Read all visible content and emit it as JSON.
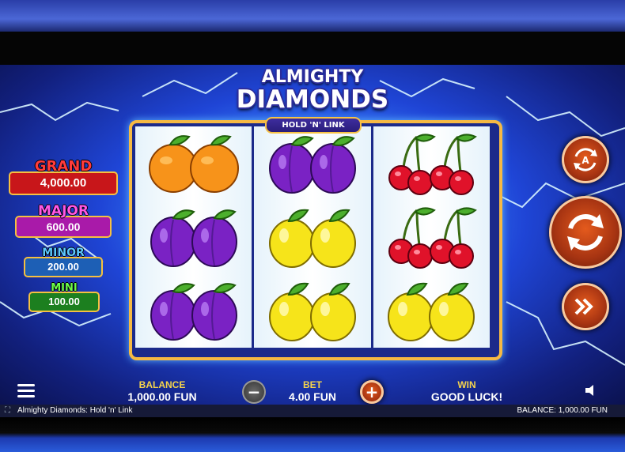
{
  "game": {
    "logo_line1": "ALMIGHTY",
    "logo_line2": "DIAMONDS",
    "badge": "HOLD 'N' LINK"
  },
  "jackpots": [
    {
      "name": "GRAND",
      "value": "4,000.00",
      "color": "#e02424",
      "text_color": "#ff3b3b"
    },
    {
      "name": "MAJOR",
      "value": "600.00",
      "color": "#b51fb8",
      "text_color": "#ff57e6"
    },
    {
      "name": "MINOR",
      "value": "200.00",
      "color": "#1f72c9",
      "text_color": "#5cc7ff"
    },
    {
      "name": "MINI",
      "value": "100.00",
      "color": "#1f8c22",
      "text_color": "#6dff4a"
    }
  ],
  "reels": [
    [
      "orange",
      "plum",
      "plum"
    ],
    [
      "plum",
      "lemon",
      "lemon"
    ],
    [
      "cherry",
      "cherry",
      "lemon"
    ]
  ],
  "controls": {
    "autoplay_icon": "autoplay-icon",
    "spin_icon": "spin-icon",
    "turbo_icon": "fast-forward-icon"
  },
  "hud": {
    "menu_icon": "hamburger-menu-icon",
    "balance_label": "BALANCE",
    "balance_value": "1,000.00 FUN",
    "bet_label": "BET",
    "bet_value": "4.00 FUN",
    "minus": "−",
    "plus": "+",
    "win_label": "WIN",
    "win_value": "GOOD LUCK!",
    "sound_icon": "speaker-icon"
  },
  "status_bar": {
    "title": "Almighty Diamonds: Hold 'n' Link",
    "balance": "BALANCE: 1,000.00 FUN"
  },
  "colors": {
    "frame_gold": "#f6b943",
    "button_orange": "#c24418",
    "label_yellow": "#f5d34c"
  }
}
